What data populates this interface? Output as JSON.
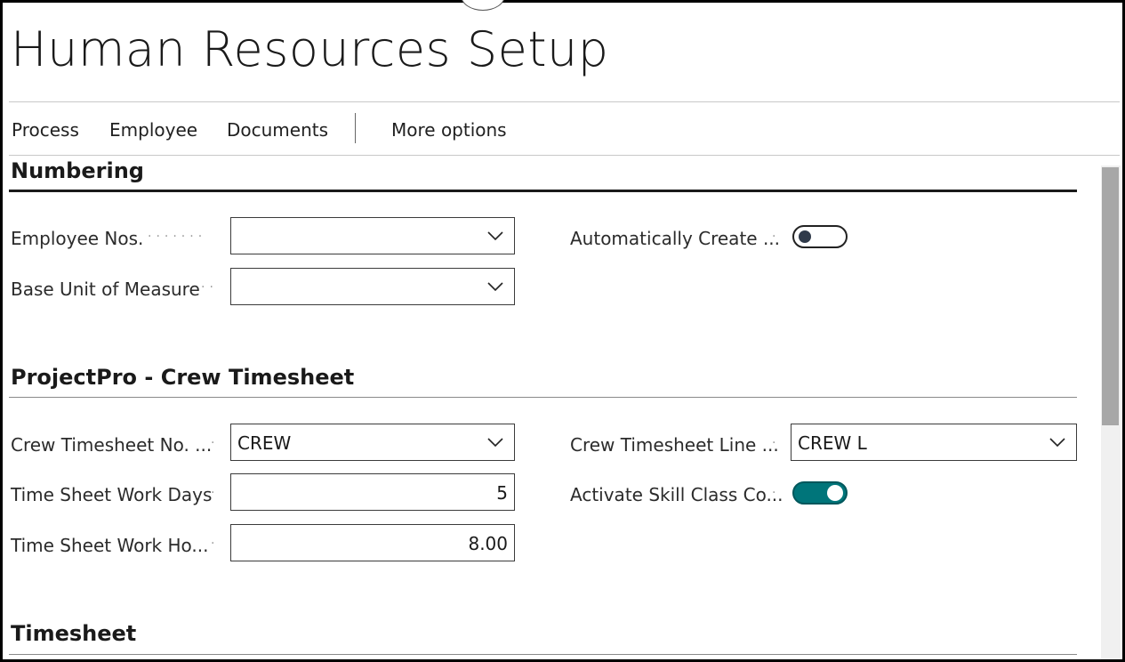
{
  "page": {
    "title": "Human Resources Setup"
  },
  "actions": {
    "process": "Process",
    "employee": "Employee",
    "documents": "Documents",
    "more_options": "More options"
  },
  "sections": {
    "numbering": {
      "title": "Numbering",
      "employee_nos_label": "Employee Nos.",
      "employee_nos_value": "",
      "base_unit_label": "Base Unit of Measure",
      "base_unit_value": "",
      "auto_create_label": "Automatically Create ...",
      "auto_create_on": false
    },
    "crew": {
      "title": "ProjectPro - Crew Timesheet",
      "crew_no_label": "Crew Timesheet No. ...",
      "crew_no_value": "CREW",
      "work_days_label": "Time Sheet Work Days",
      "work_days_value": "5",
      "work_hours_label": "Time Sheet Work Ho...",
      "work_hours_value": "8.00",
      "crew_line_label": "Crew Timesheet Line ...",
      "crew_line_value": "CREW L",
      "skill_class_label": "Activate Skill Class Co...",
      "skill_class_on": true
    },
    "timesheet": {
      "title": "Timesheet"
    }
  },
  "icons": {
    "dropdown": "chevron-down-icon"
  },
  "colors": {
    "toggle_on": "#00757a",
    "toggle_off_knob": "#2f3a4a"
  }
}
